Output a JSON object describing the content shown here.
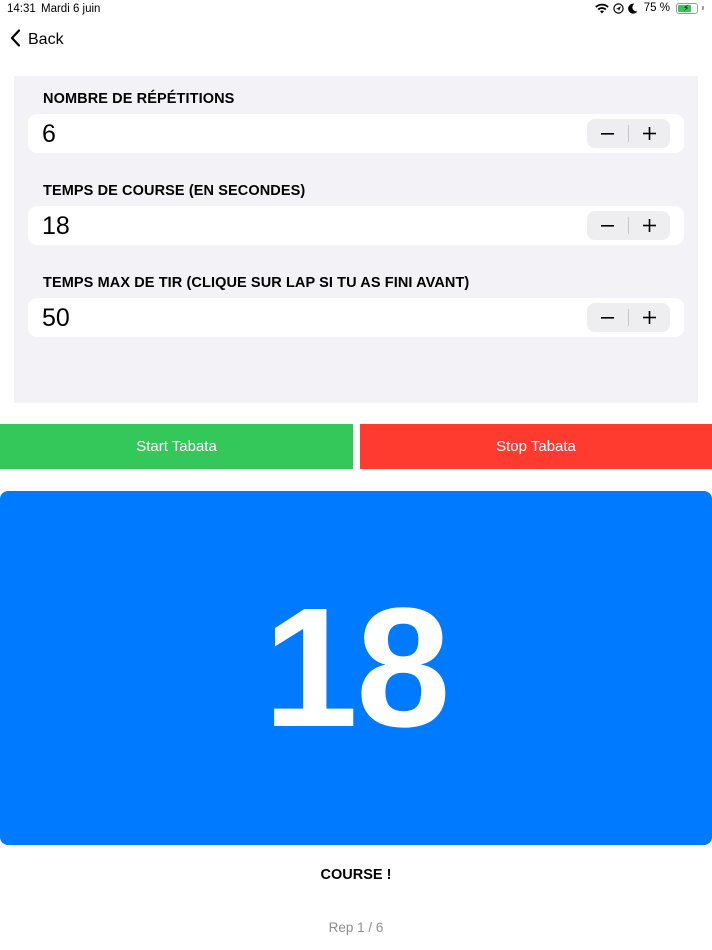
{
  "status_bar": {
    "time": "14:31",
    "date": "Mardi 6 juin",
    "battery_percent": "75 %",
    "battery_level": 0.75,
    "icons": [
      "wifi-icon",
      "location-icon",
      "moon-icon",
      "battery-icon"
    ]
  },
  "nav": {
    "back_label": "Back"
  },
  "form": {
    "fields": [
      {
        "label": "NOMBRE DE RÉPÉTITIONS",
        "value": "6"
      },
      {
        "label": "TEMPS DE COURSE (EN SECONDES)",
        "value": "18"
      },
      {
        "label": "TEMPS MAX DE TIR (CLIQUE SUR LAP SI TU AS FINI AVANT)",
        "value": "50"
      }
    ]
  },
  "actions": {
    "start_label": "Start Tabata",
    "stop_label": "Stop Tabata"
  },
  "timer": {
    "value": "18",
    "phase": "COURSE !",
    "rep_counter": "Rep 1 / 6"
  },
  "colors": {
    "start": "#34c759",
    "stop": "#ff3b30",
    "timer_background": "#007aff",
    "panel_background": "#f2f2f7"
  }
}
